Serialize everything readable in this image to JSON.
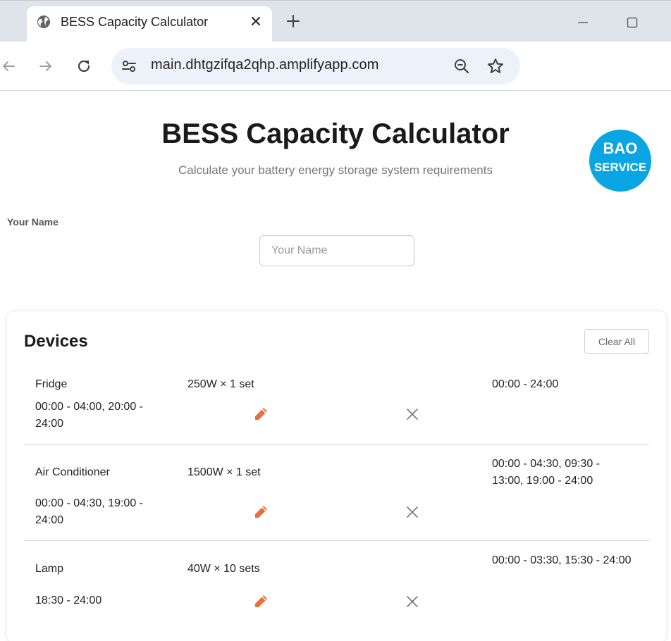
{
  "browser": {
    "tab_title": "BESS Capacity Calculator",
    "url": "main.dhtgzifqa2qhp.amplifyapp.com",
    "icons": [
      "globe-icon",
      "close-icon",
      "plus-icon",
      "minimize-icon",
      "maximize-icon",
      "back-arrow-icon",
      "forward-arrow-icon",
      "reload-icon",
      "site-settings-icon",
      "zoom-out-icon",
      "star-icon"
    ]
  },
  "page": {
    "title": "BESS Capacity Calculator",
    "subtitle": "Calculate your battery energy storage system requirements",
    "logo": {
      "line1": "BAO",
      "line2": "SERVICE",
      "color": "#0aa5e3"
    }
  },
  "form": {
    "name_label": "Your Name",
    "name_value": "",
    "name_placeholder": "Your Name"
  },
  "devices": {
    "title": "Devices",
    "clear_all_label": "Clear All",
    "items": [
      {
        "name": "Fridge",
        "power": "250W × 1 set",
        "hours": "00:00 - 24:00",
        "schedule": "00:00 - 04:00, 20:00 - 24:00"
      },
      {
        "name": "Air Conditioner",
        "power": "1500W × 1 set",
        "hours": "00:00 - 04:30, 09:30 - 13:00, 19:00 - 24:00",
        "schedule": "00:00 - 04:30, 19:00 - 24:00"
      },
      {
        "name": "Lamp",
        "power": "40W × 10 sets",
        "hours": "00:00 - 03:30, 15:30 - 24:00",
        "schedule": "18:30 - 24:00"
      }
    ],
    "edit_icon": "pencil-icon",
    "delete_icon": "close-icon",
    "edit_color": "#e8703a"
  }
}
